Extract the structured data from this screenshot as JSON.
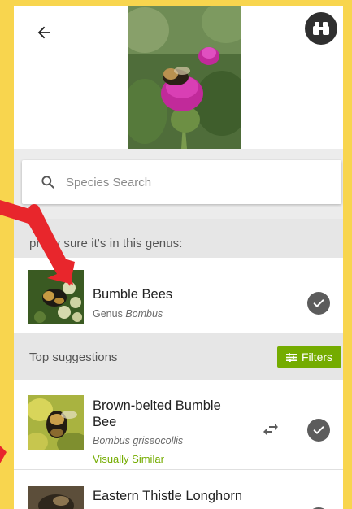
{
  "colors": {
    "accent_green": "#74ac00",
    "frame_yellow": "#F8D54E",
    "arrow_red": "#E8262C"
  },
  "topbar": {
    "back_icon": "arrow-left-icon",
    "binoculars_icon": "binoculars-icon"
  },
  "search": {
    "placeholder": "Species Search"
  },
  "genus_section": {
    "header_visible": "pretty sure it's in this genus:",
    "name": "Bumble Bees",
    "rank": "Genus",
    "genus": "Bombus"
  },
  "suggestions": {
    "header": "Top suggestions",
    "filters_label": "Filters",
    "items": [
      {
        "name": "Brown-belted Bumble Bee",
        "scientific": "Bombus griseocollis",
        "tag": "Visually Similar"
      },
      {
        "name": "Eastern Thistle Longhorn"
      }
    ]
  }
}
